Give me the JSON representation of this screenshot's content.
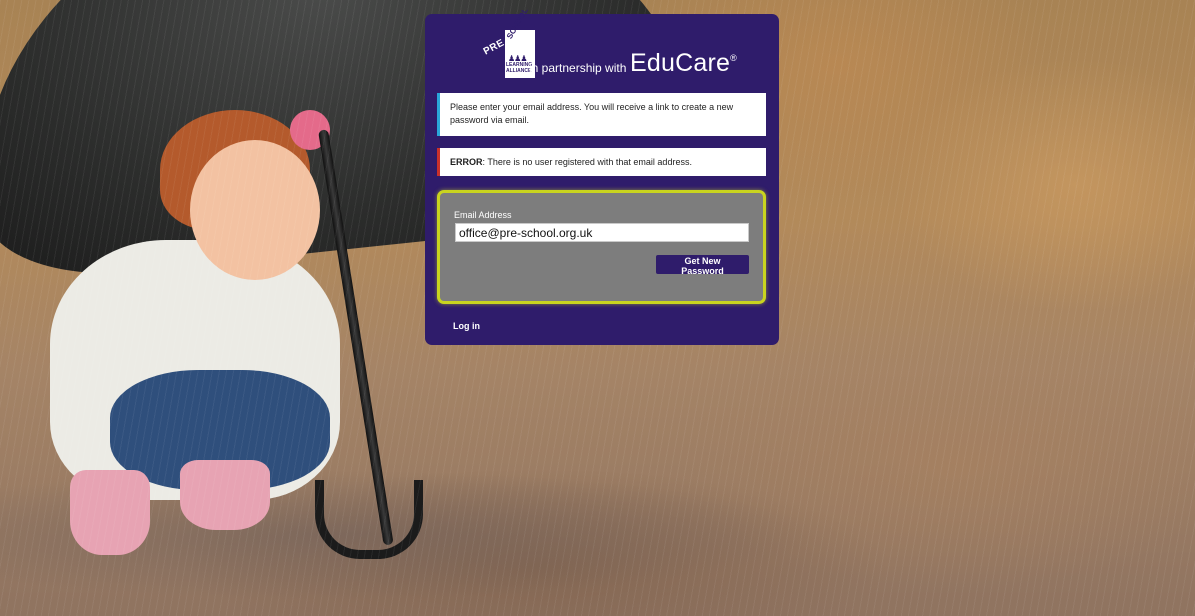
{
  "logo": {
    "pre": "PRE",
    "school": "SCHOOL",
    "line1": "LEARNING",
    "line2": "ALLIANCE",
    "icon": "children-figures-icon"
  },
  "brand": {
    "partner_text": "in partnership with",
    "name": "EduCare",
    "mark": "®"
  },
  "messages": {
    "info": "Please enter your email address. You will receive a link to create a new password via email.",
    "error_label": "ERROR",
    "error_text": ": There is no user registered with that email address."
  },
  "form": {
    "email_label": "Email Address",
    "email_value": "office@pre-school.org.uk",
    "submit_label": "Get New Password"
  },
  "footer": {
    "login_link": "Log in"
  },
  "colors": {
    "card": "#2f1c6b",
    "info_accent": "#2aa6d9",
    "error_accent": "#c9312b",
    "form_border": "#c9d41f",
    "form_bg": "#7d7d7d"
  }
}
